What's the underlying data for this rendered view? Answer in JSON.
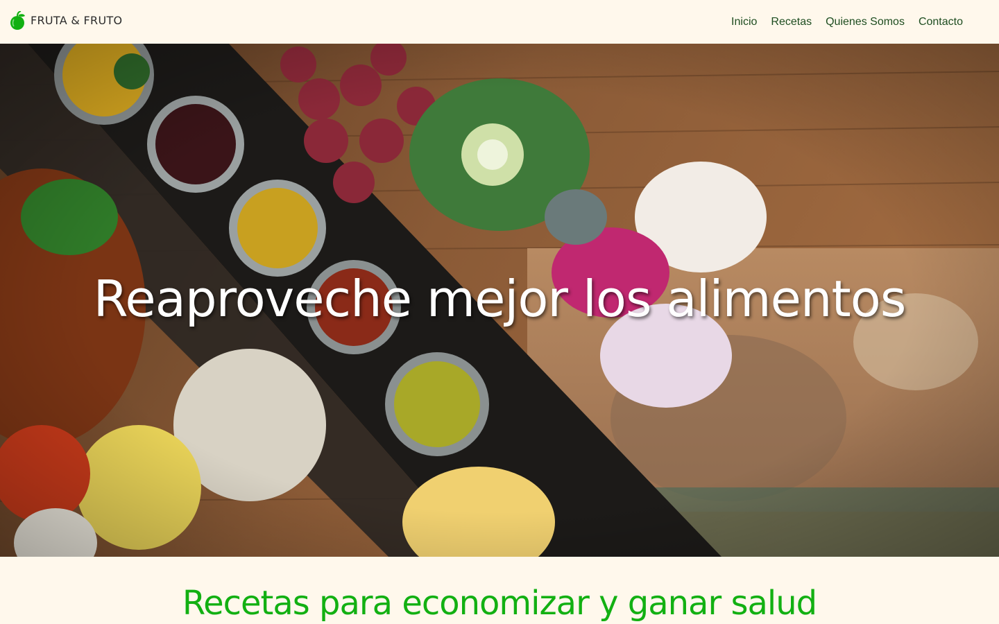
{
  "brand": {
    "name": "FRUTA & FRUTO",
    "icon": "green-fruit-logo-icon",
    "color": "#12b012"
  },
  "nav": {
    "items": [
      {
        "label": "Inicio"
      },
      {
        "label": "Recetas"
      },
      {
        "label": "Quienes Somos"
      },
      {
        "label": "Contacto"
      }
    ],
    "color": "#1e4d20"
  },
  "hero": {
    "title": "Reaproveche mejor los alimentos",
    "image": "food-table-photo"
  },
  "section": {
    "title": "Recetas para economizar y ganar salud",
    "color": "#12b012"
  },
  "colors": {
    "background": "#fff8ec",
    "accent": "#12b012"
  }
}
